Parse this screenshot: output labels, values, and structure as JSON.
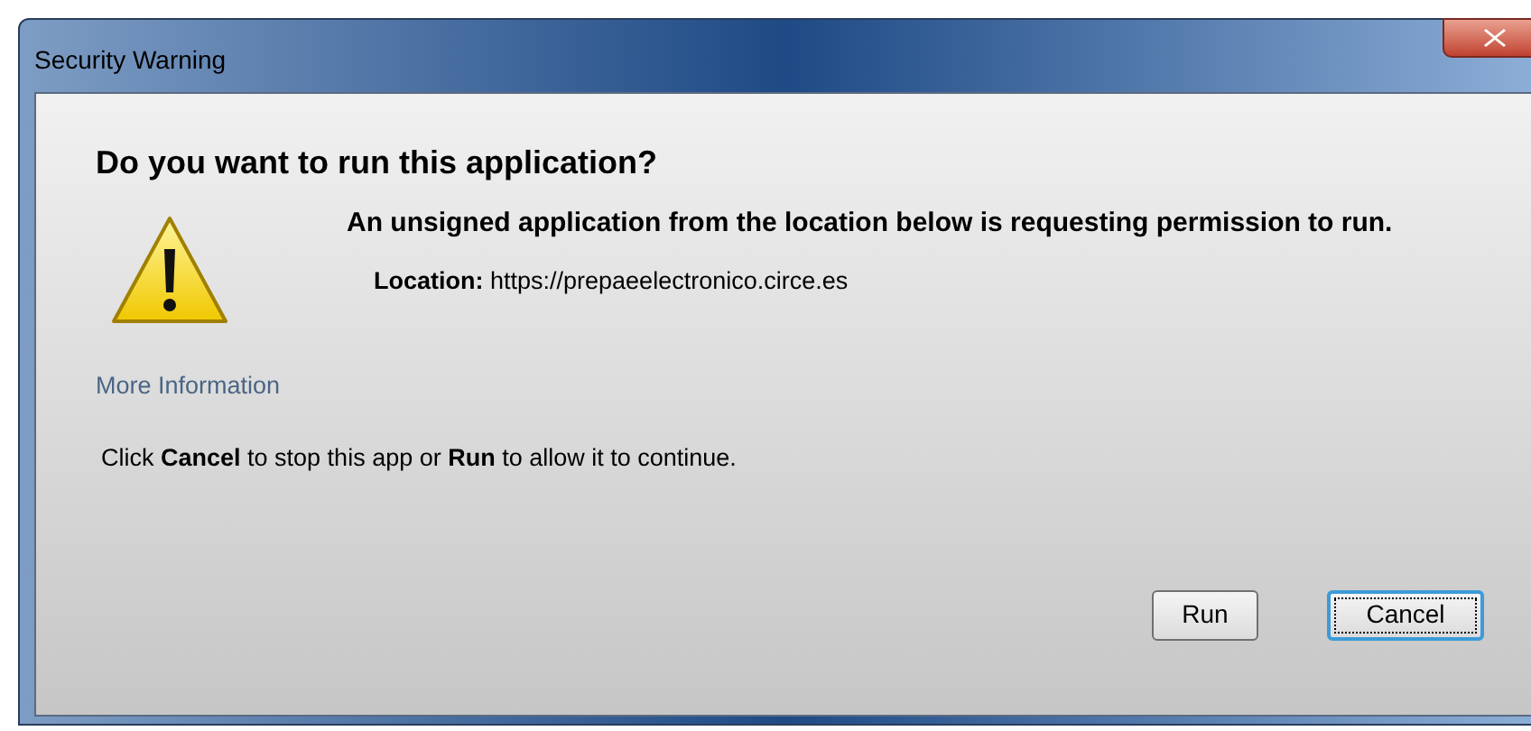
{
  "window": {
    "title": "Security Warning"
  },
  "heading": "Do you want to run this application?",
  "message": "An unsigned application from the location below is requesting permission to run.",
  "location": "**Location:** https://prepaeelectronico.circe.es",
  "more_information": "More Information",
  "instruction": "Click **Cancel** to stop this app or **Run** to allow it to continue.",
  "buttons": [
    {
      "label": "Run",
      "focused": false
    },
    {
      "label": "Cancel",
      "focused": true
    }
  ]
}
